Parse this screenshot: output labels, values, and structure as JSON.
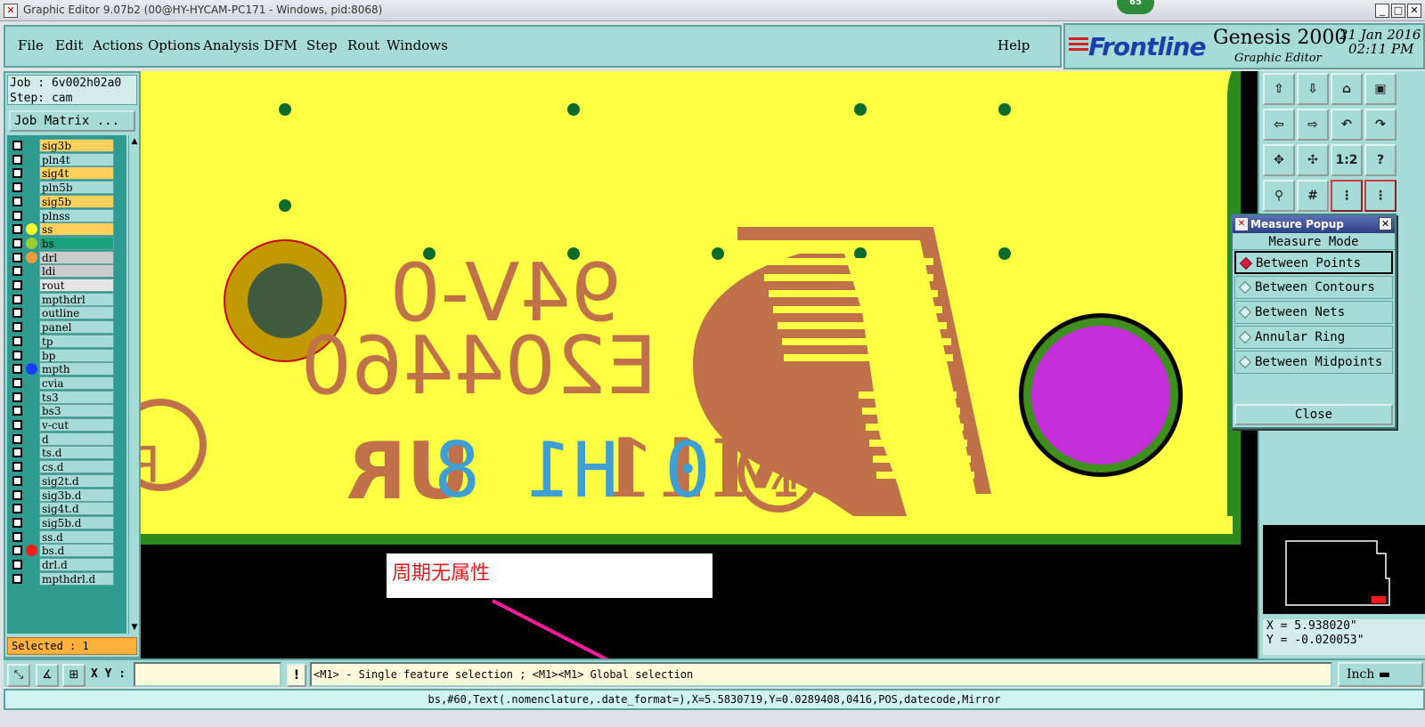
{
  "window": {
    "title": "Graphic Editor 9.07b2 (00@HY-HYCAM-PC171 - Windows, pid:8068)",
    "badge": "65"
  },
  "menu": {
    "items": [
      "File",
      "Edit",
      "Actions",
      "Options",
      "Analysis",
      "DFM",
      "Step",
      "Rout",
      "Windows"
    ],
    "help": "Help"
  },
  "brand": {
    "logo": "Frontline",
    "product": "Genesis 2000",
    "subtitle": "Graphic Editor",
    "date": "21 Jan 2016",
    "time": "02:11 PM"
  },
  "job": {
    "job_line": "Job : 6v002h02a0",
    "step_line": "Step: cam",
    "matrix_button": "Job Matrix ..."
  },
  "layers": [
    {
      "name": "sig3b",
      "color": "#ffd05a",
      "dot": null
    },
    {
      "name": "pln4t",
      "color": "#a6dbd8",
      "dot": null
    },
    {
      "name": "sig4t",
      "color": "#ffd05a",
      "dot": null
    },
    {
      "name": "pln5b",
      "color": "#a6dbd8",
      "dot": null
    },
    {
      "name": "sig5b",
      "color": "#ffd05a",
      "dot": null
    },
    {
      "name": "plnss",
      "color": "#a6dbd8",
      "dot": null
    },
    {
      "name": "ss",
      "color": "#ffd05a",
      "dot": "#ffff30"
    },
    {
      "name": "bs",
      "color": "#1aa07e",
      "dot": "#9acd32"
    },
    {
      "name": "drl",
      "color": "#cccccc",
      "dot": "#f09a3a"
    },
    {
      "name": "ldi",
      "color": "#cccccc",
      "dot": null
    },
    {
      "name": "rout",
      "color": "#e6e6e6",
      "dot": null
    },
    {
      "name": "mpthdrl",
      "color": "#a6dbd8",
      "dot": null
    },
    {
      "name": "outline",
      "color": "#a6dbd8",
      "dot": null
    },
    {
      "name": "panel",
      "color": "#a6dbd8",
      "dot": null
    },
    {
      "name": "tp",
      "color": "#a6dbd8",
      "dot": null
    },
    {
      "name": "bp",
      "color": "#a6dbd8",
      "dot": null
    },
    {
      "name": "mpth",
      "color": "#a6dbd8",
      "dot": "#1a3cff"
    },
    {
      "name": "cvia",
      "color": "#a6dbd8",
      "dot": null
    },
    {
      "name": "ts3",
      "color": "#a6dbd8",
      "dot": null
    },
    {
      "name": "bs3",
      "color": "#a6dbd8",
      "dot": null
    },
    {
      "name": "v-cut",
      "color": "#a6dbd8",
      "dot": null
    },
    {
      "name": "d",
      "color": "#a6dbd8",
      "dot": null
    },
    {
      "name": "ts.d",
      "color": "#a6dbd8",
      "dot": null
    },
    {
      "name": "cs.d",
      "color": "#a6dbd8",
      "dot": null
    },
    {
      "name": "sig2t.d",
      "color": "#a6dbd8",
      "dot": null
    },
    {
      "name": "sig3b.d",
      "color": "#a6dbd8",
      "dot": null
    },
    {
      "name": "sig4t.d",
      "color": "#a6dbd8",
      "dot": null
    },
    {
      "name": "sig5b.d",
      "color": "#a6dbd8",
      "dot": null
    },
    {
      "name": "ss.d",
      "color": "#a6dbd8",
      "dot": null
    },
    {
      "name": "bs.d",
      "color": "#a6dbd8",
      "dot": "#ff1a1a"
    },
    {
      "name": "drl.d",
      "color": "#a6dbd8",
      "dot": null
    },
    {
      "name": "mpthdrl.d",
      "color": "#a6dbd8",
      "dot": null
    }
  ],
  "selected_text": "Selected : 1",
  "board": {
    "text_line1": "94V-0",
    "text_line2": "E204460",
    "text_line3": "M11",
    "datecode": "0 H1 8",
    "annotation": "周期无属性",
    "colors": {
      "board": "#ffff44",
      "copper": "#c0714a",
      "pad_ring": "#c09a00",
      "pad_center": "#3f5a3f",
      "magenta_pad": "#c32ed8",
      "via": "#0b6b2a",
      "datecode": "#3f9fd2",
      "arrow": "#ff1aa0"
    }
  },
  "toolbar": {
    "buttons": [
      "zoom-home",
      "zoom-down",
      "zoom-house",
      "zoom-window",
      "pan-left",
      "pan-right",
      "undo-view",
      "redo-view",
      "fit-all",
      "fit-profile",
      "one-to-one",
      "help",
      "measure",
      "grid",
      "snap-red",
      "snap-red2"
    ]
  },
  "measure_popup": {
    "title": "Measure Popup",
    "mode_label": "Measure Mode",
    "options": [
      "Between Points",
      "Between Contours",
      "Between Nets",
      "Annular Ring",
      "Between Midpoints"
    ],
    "selected_index": 0,
    "close_label": "Close"
  },
  "coords": {
    "x": "X = 5.938020\"",
    "y": "Y = -0.020053\""
  },
  "bottom": {
    "xy_label": "X Y :",
    "xy_value": "",
    "prompt": "<M1> - Single feature selection ; <M1><M1> Global selection",
    "units": "Inch",
    "status": "bs,#60,Text(.nomenclature,.date_format=),X=5.5830719,Y=0.0289408,0416,POS,datecode,Mirror"
  }
}
